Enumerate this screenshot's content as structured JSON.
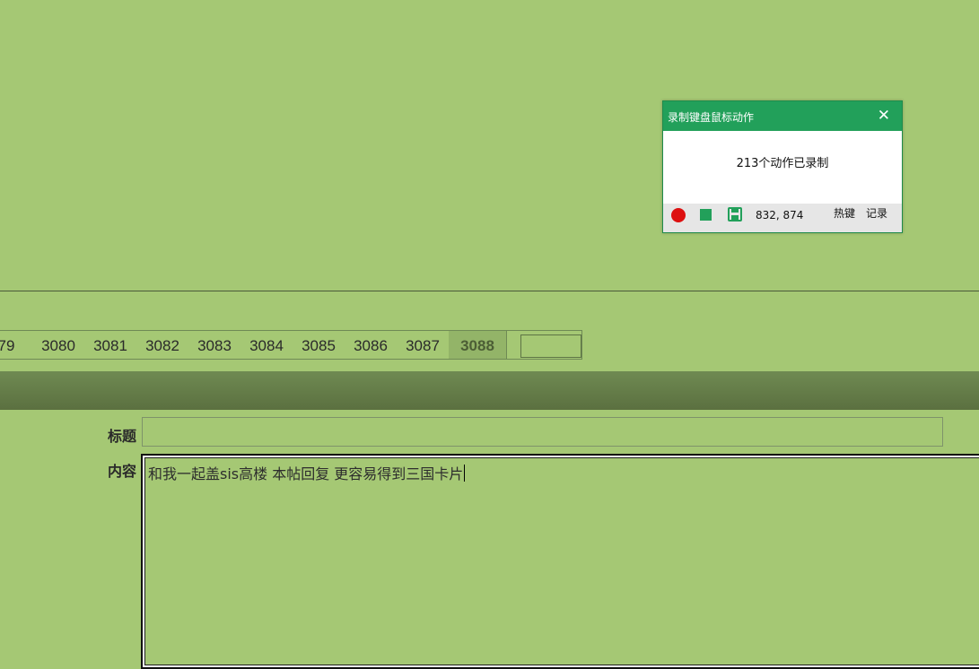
{
  "pager": {
    "pages": [
      "79",
      "3080",
      "3081",
      "3082",
      "3083",
      "3084",
      "3085",
      "3086",
      "3087"
    ],
    "current": "3088",
    "jump_value": ""
  },
  "form": {
    "title_label": "标题",
    "title_value": "",
    "content_label": "内容",
    "content_value": "和我一起盖sis高楼 本帖回复 更容易得到三国卡片"
  },
  "recorder": {
    "title": "录制键盘鼠标动作",
    "status": "213个动作已录制",
    "coords": "832, 874",
    "hotkey_label": "热键",
    "log_label": "记录",
    "colors": {
      "accent": "#22a05a",
      "record": "#dd1010"
    },
    "icons": [
      "close-icon",
      "record-icon",
      "stop-icon",
      "save-icon"
    ]
  },
  "colors": {
    "background": "#a5c874",
    "banner": "#647a48"
  }
}
